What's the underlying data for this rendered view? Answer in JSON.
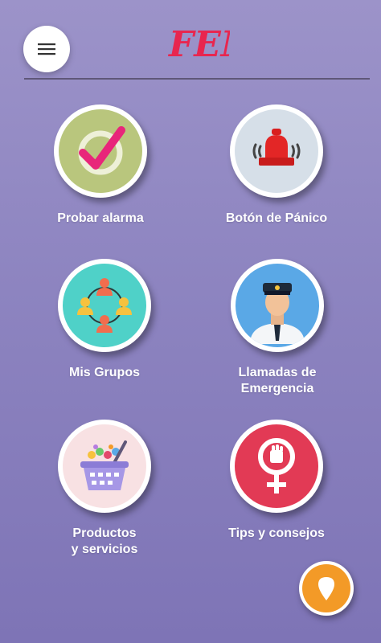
{
  "header": {
    "logo_text": "FEM",
    "menu_icon": "hamburger-menu-icon",
    "brand_color": "#e8264f"
  },
  "tiles": [
    {
      "label": "Probar alarma",
      "icon": "checkmark-icon",
      "bg": "#b9c67d"
    },
    {
      "label": "Botón de Pánico",
      "icon": "alarm-bell-icon",
      "bg": "#d6dfe8"
    },
    {
      "label": "Mis Grupos",
      "icon": "group-network-icon",
      "bg": "#4fd1c8"
    },
    {
      "label": "Llamadas de\nEmergencia",
      "icon": "police-officer-icon",
      "bg": "#5aa8e6"
    },
    {
      "label": "Productos\ny servicios",
      "icon": "shopping-basket-icon",
      "bg": "#f8e1e3"
    },
    {
      "label": "Tips y consejos",
      "icon": "feminist-symbol-icon",
      "bg": "#e23a55"
    }
  ],
  "fab": {
    "icon": "location-pin-icon",
    "color": "#f39a27"
  }
}
